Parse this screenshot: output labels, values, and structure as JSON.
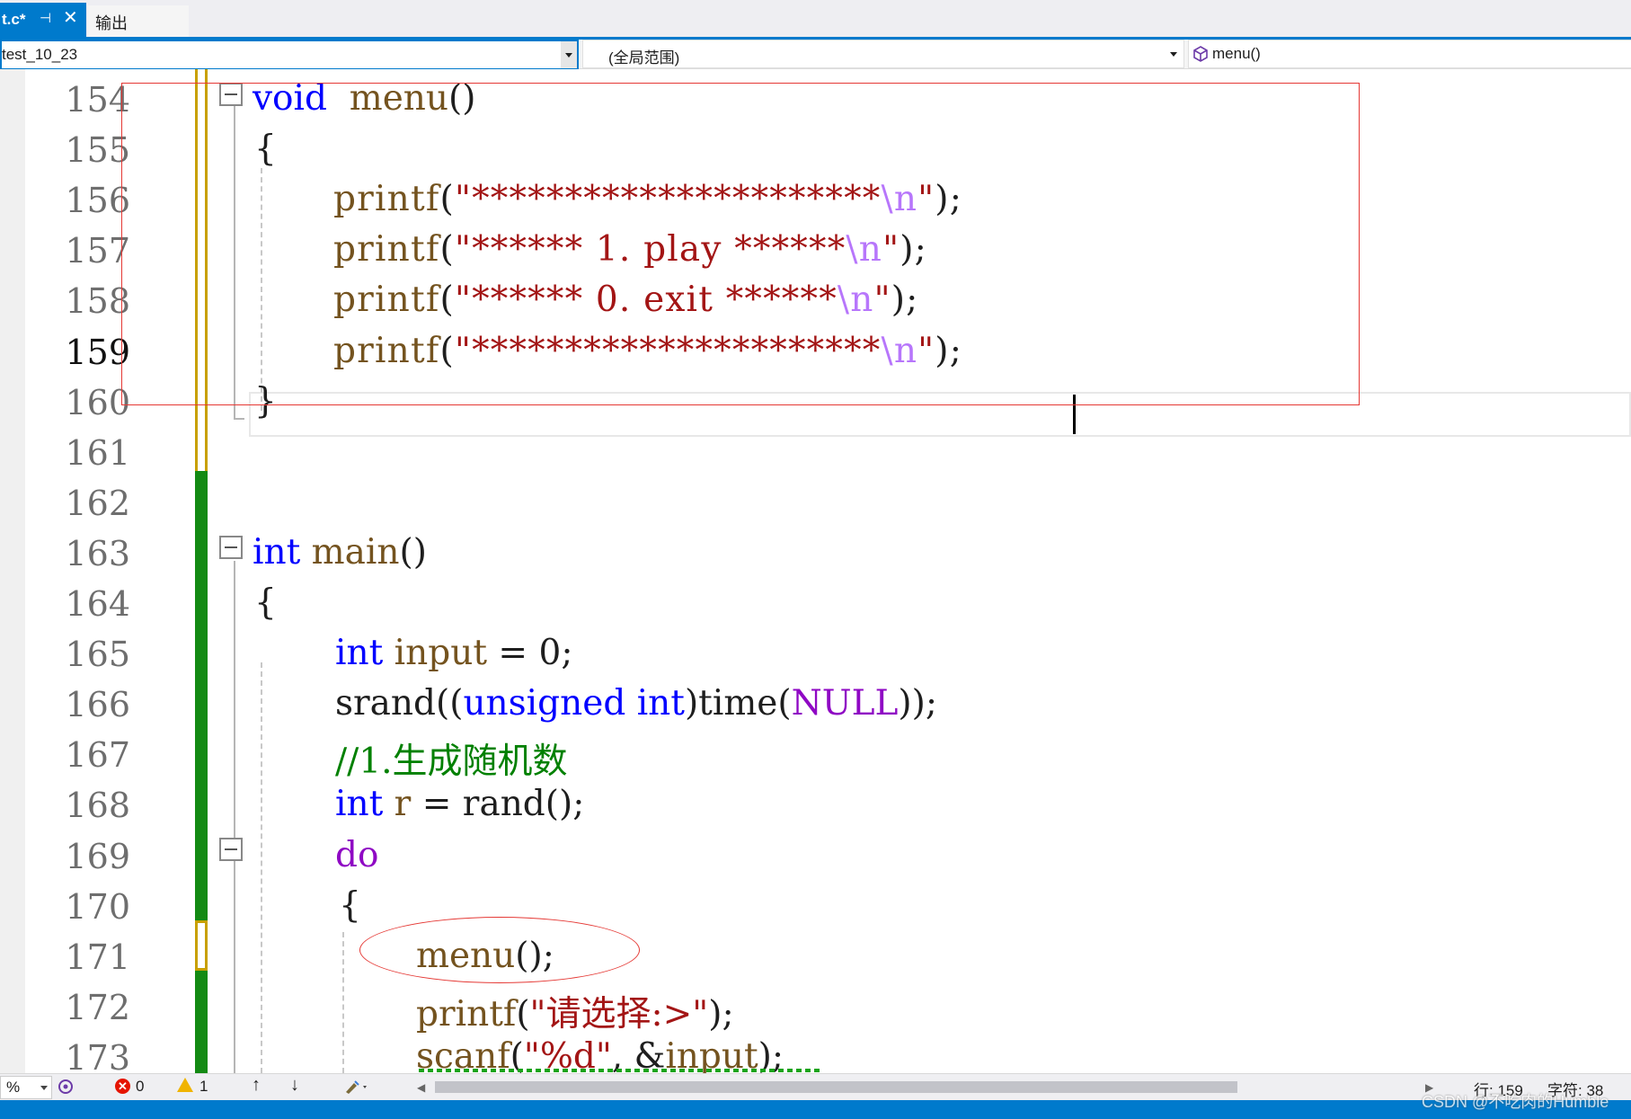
{
  "tabs": [
    {
      "label": "t.c*",
      "active": true
    },
    {
      "label": "输出",
      "active": false
    }
  ],
  "tab_icons": {
    "pin": "pin-icon",
    "close": "close-icon"
  },
  "navbar": {
    "project": "test_10_23",
    "scope": "(全局范围)",
    "member": "menu()",
    "member_icon": "cube-icon"
  },
  "editor": {
    "current_line": 159,
    "lines": [
      {
        "num": "154",
        "tokens": [
          [
            "kw",
            "void"
          ],
          [
            "",
            "  "
          ],
          [
            "fn",
            "menu"
          ],
          [
            "",
            "()"
          ]
        ]
      },
      {
        "num": "155",
        "tokens": [
          [
            "",
            "{"
          ]
        ]
      },
      {
        "num": "156",
        "tokens": [
          [
            "fn",
            "printf"
          ],
          [
            "",
            "("
          ],
          [
            "str",
            "\"**********************"
          ],
          [
            "esc",
            "\\n"
          ],
          [
            "str",
            "\""
          ],
          [
            "",
            ");"
          ]
        ]
      },
      {
        "num": "157",
        "tokens": [
          [
            "fn",
            "printf"
          ],
          [
            "",
            "("
          ],
          [
            "str",
            "\"****** 1. play ******"
          ],
          [
            "esc",
            "\\n"
          ],
          [
            "str",
            "\""
          ],
          [
            "",
            ");"
          ]
        ]
      },
      {
        "num": "158",
        "tokens": [
          [
            "fn",
            "printf"
          ],
          [
            "",
            "("
          ],
          [
            "str",
            "\"****** 0. exit ******"
          ],
          [
            "esc",
            "\\n"
          ],
          [
            "str",
            "\""
          ],
          [
            "",
            ");"
          ]
        ]
      },
      {
        "num": "159",
        "tokens": [
          [
            "fn",
            "printf"
          ],
          [
            "",
            "("
          ],
          [
            "str",
            "\"**********************"
          ],
          [
            "esc",
            "\\n"
          ],
          [
            "str",
            "\""
          ],
          [
            "",
            ");"
          ]
        ]
      },
      {
        "num": "160",
        "tokens": [
          [
            "",
            "}"
          ]
        ]
      },
      {
        "num": "161",
        "tokens": []
      },
      {
        "num": "162",
        "tokens": []
      },
      {
        "num": "163",
        "tokens": [
          [
            "kw",
            "int"
          ],
          [
            "",
            " "
          ],
          [
            "fn",
            "main"
          ],
          [
            "",
            "()"
          ]
        ]
      },
      {
        "num": "164",
        "tokens": [
          [
            "",
            "{"
          ]
        ]
      },
      {
        "num": "165",
        "tokens": [
          [
            "kw",
            "int"
          ],
          [
            "",
            " "
          ],
          [
            "fn",
            "input"
          ],
          [
            "",
            " = 0;"
          ]
        ]
      },
      {
        "num": "166",
        "tokens": [
          [
            "",
            "srand(("
          ],
          [
            "kw",
            "unsigned"
          ],
          [
            "",
            " "
          ],
          [
            "kw",
            "int"
          ],
          [
            "",
            ")time("
          ],
          [
            "kw2",
            "NULL"
          ],
          [
            "",
            "));"
          ]
        ]
      },
      {
        "num": "167",
        "tokens": [
          [
            "cm",
            "//1.生成随机数"
          ]
        ]
      },
      {
        "num": "168",
        "tokens": [
          [
            "kw",
            "int"
          ],
          [
            "",
            " "
          ],
          [
            "fn",
            "r"
          ],
          [
            "",
            " = rand();"
          ]
        ]
      },
      {
        "num": "169",
        "tokens": [
          [
            "kw2",
            "do"
          ]
        ]
      },
      {
        "num": "170",
        "tokens": [
          [
            "",
            "{"
          ]
        ]
      },
      {
        "num": "171",
        "tokens": [
          [
            "fn",
            "menu"
          ],
          [
            "",
            "();"
          ]
        ]
      },
      {
        "num": "172",
        "tokens": [
          [
            "fn",
            "printf"
          ],
          [
            "",
            "("
          ],
          [
            "str",
            "\"请选择:>\""
          ],
          [
            "",
            ");"
          ]
        ]
      },
      {
        "num": "173",
        "tokens": [
          [
            "fn",
            "scanf"
          ],
          [
            "",
            "("
          ],
          [
            "str",
            "\"%d\""
          ],
          [
            "",
            ", &"
          ],
          [
            "fn",
            "input"
          ],
          [
            "",
            ");"
          ]
        ]
      }
    ]
  },
  "statusbar": {
    "zoom": "%",
    "errors": "0",
    "warnings": "1",
    "row": "行: 159",
    "col": "字符: 38",
    "error_icon": "error-icon",
    "warning_icon": "warning-icon"
  },
  "watermark": "CSDN @不吃肉的Humble",
  "colors": {
    "accent": "#007acc",
    "keyword": "#0000ff",
    "control": "#8f08c4",
    "function": "#74531f",
    "string": "#a31515",
    "escape": "#b776fb",
    "comment": "#008000",
    "annotation": "#e53935",
    "change_saved": "#138a13",
    "change_unsaved": "#c8a000"
  }
}
